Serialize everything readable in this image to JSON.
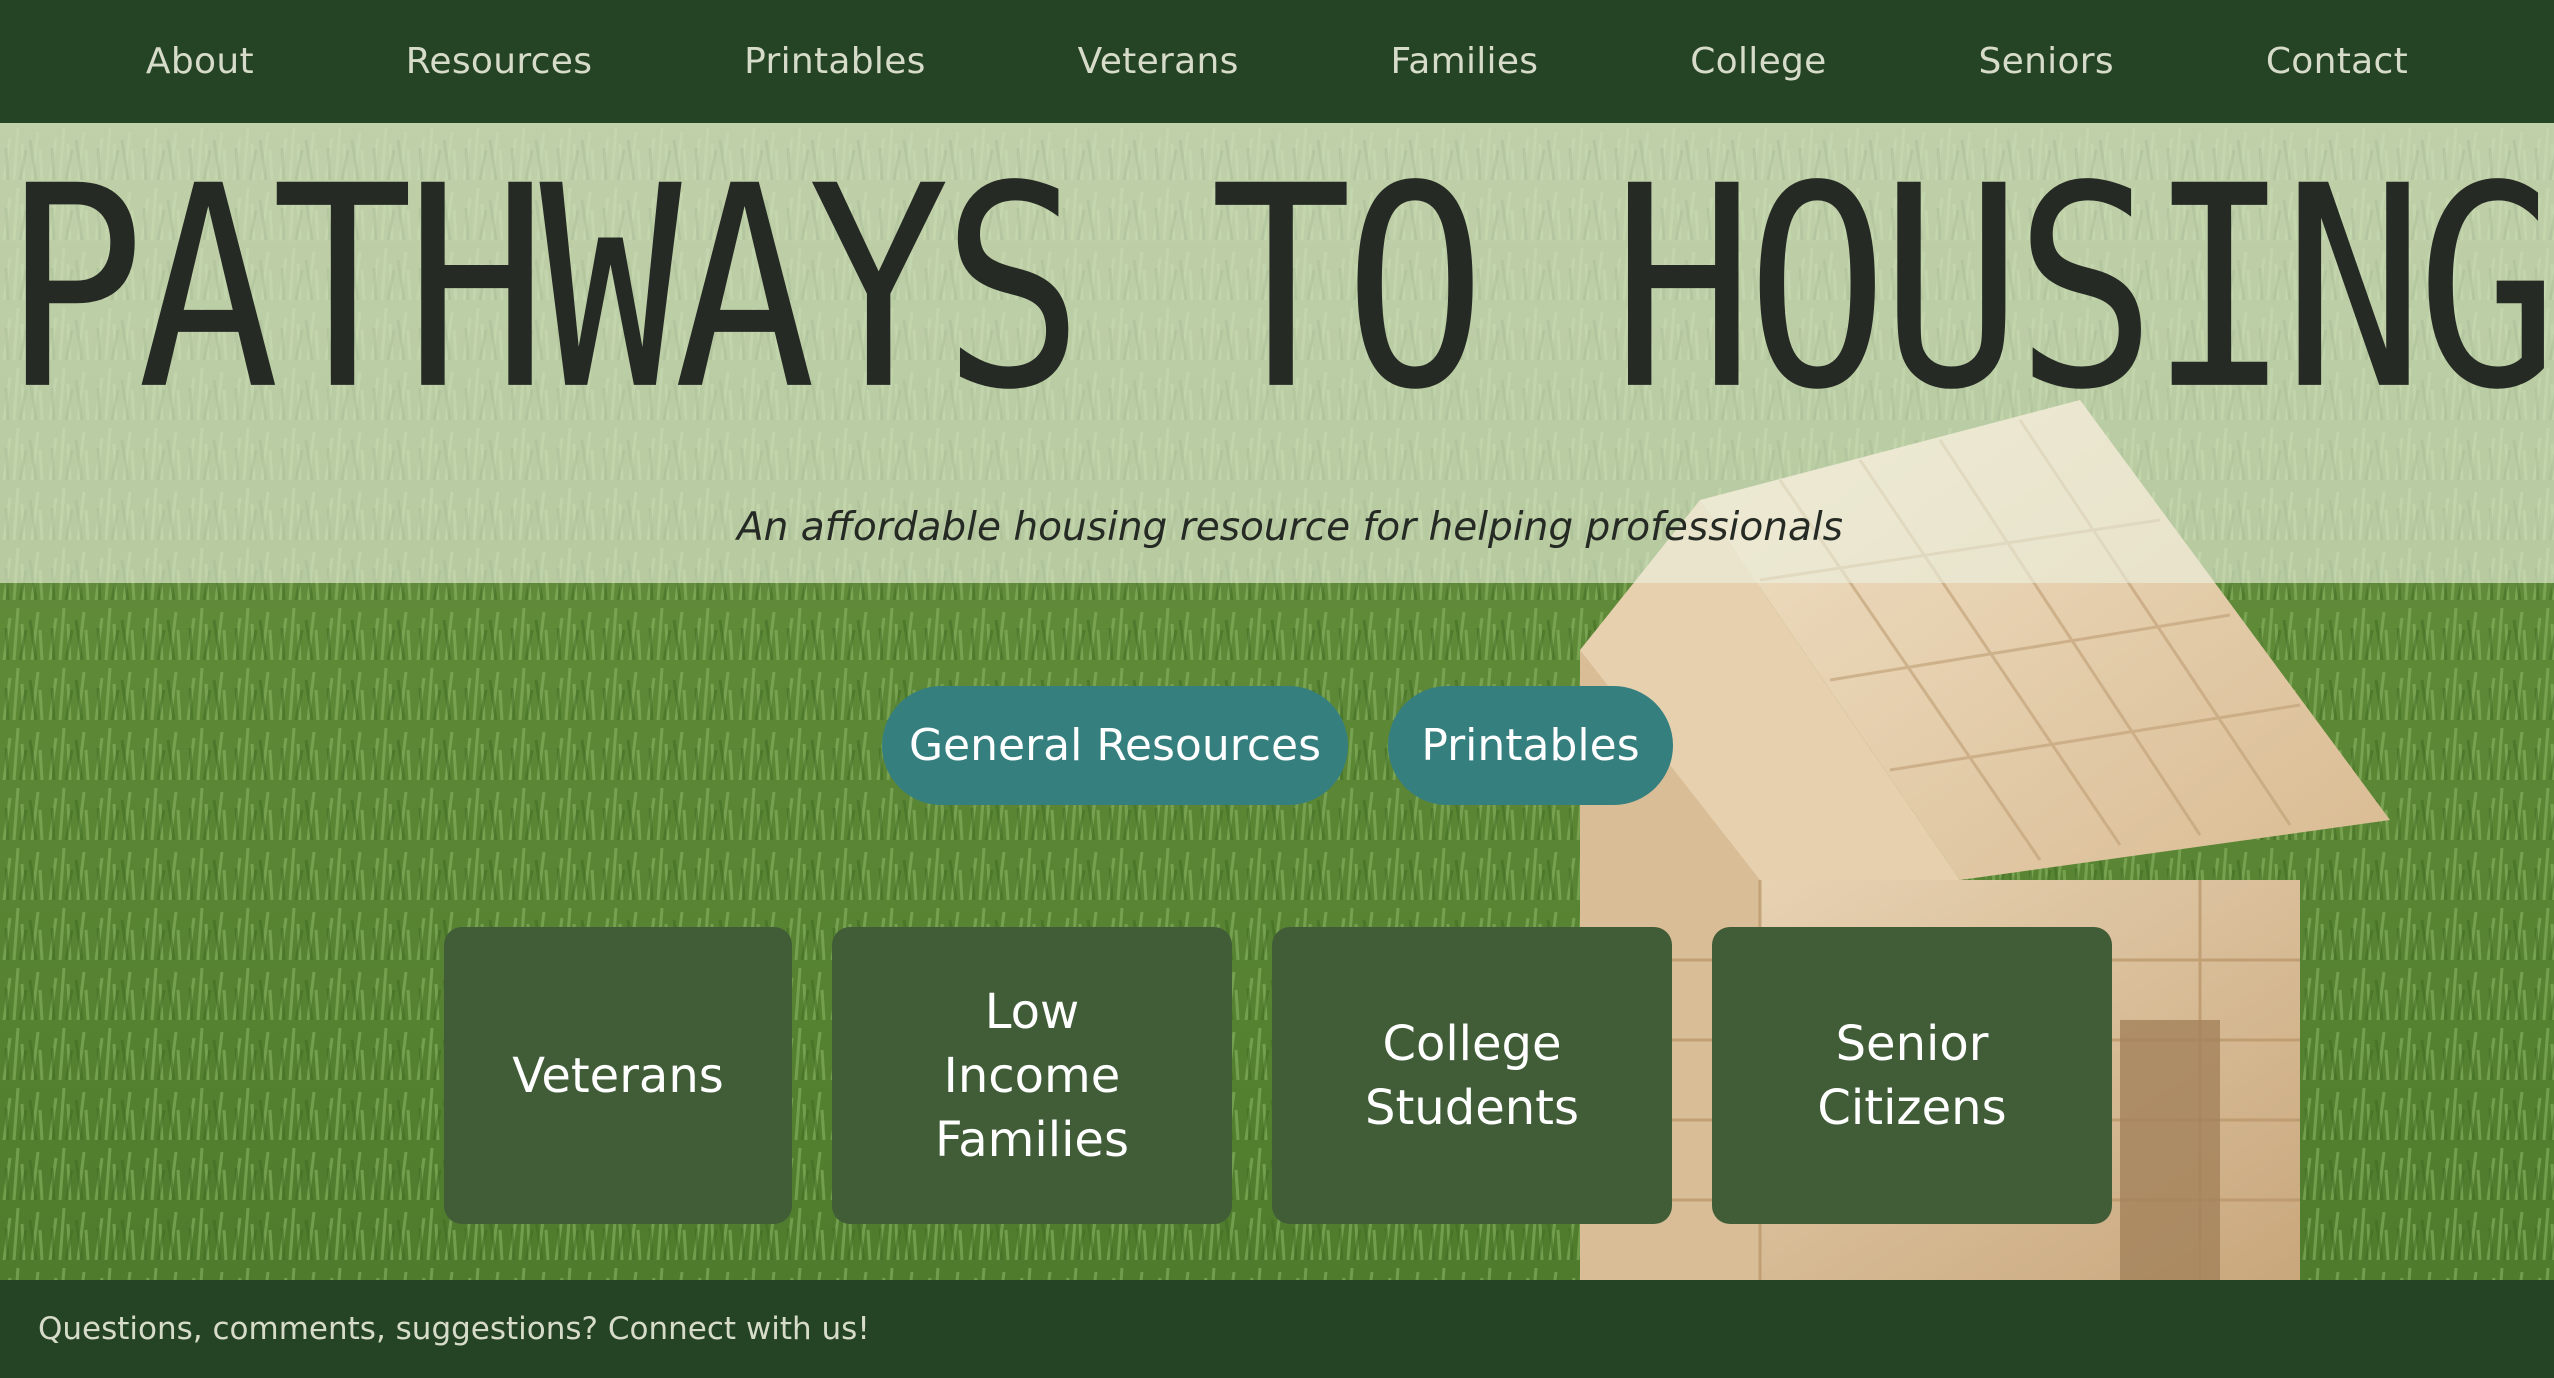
{
  "nav": {
    "items": [
      {
        "label": "About"
      },
      {
        "label": "Resources"
      },
      {
        "label": "Printables"
      },
      {
        "label": "Veterans"
      },
      {
        "label": "Families"
      },
      {
        "label": "College"
      },
      {
        "label": "Seniors"
      },
      {
        "label": "Contact"
      }
    ]
  },
  "hero": {
    "title": "PATHWAYS TO HOUSING",
    "subtitle": "An affordable housing resource for helping professionals"
  },
  "buttons": {
    "general_resources": "General Resources",
    "printables": "Printables"
  },
  "tiles": [
    {
      "label": "Veterans"
    },
    {
      "label": "Low\nIncome\nFamilies"
    },
    {
      "label": "College\nStudents"
    },
    {
      "label": "Senior\nCitizens"
    }
  ],
  "footer": {
    "text": "Questions, comments, suggestions? Connect with us!"
  },
  "colors": {
    "nav_background": "#254325",
    "nav_text": "#d6dcc9",
    "pill_background": "#357f7f",
    "tile_background": "#405d38",
    "title_text": "#262a24"
  }
}
